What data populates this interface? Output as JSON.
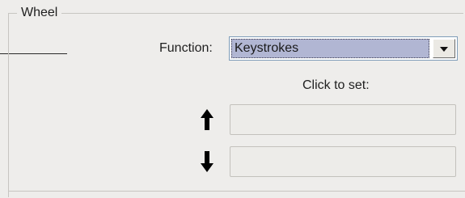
{
  "group": {
    "title": "Wheel"
  },
  "function": {
    "label": "Function:",
    "selected": "Keystrokes"
  },
  "click_to_set": {
    "label": "Click to set:"
  },
  "icons": {
    "up": "arrow-up-icon",
    "down": "arrow-down-icon",
    "dropdown": "chevron-down-icon"
  },
  "colors": {
    "selection": "#b1b6d3",
    "background": "#eeedeb"
  }
}
